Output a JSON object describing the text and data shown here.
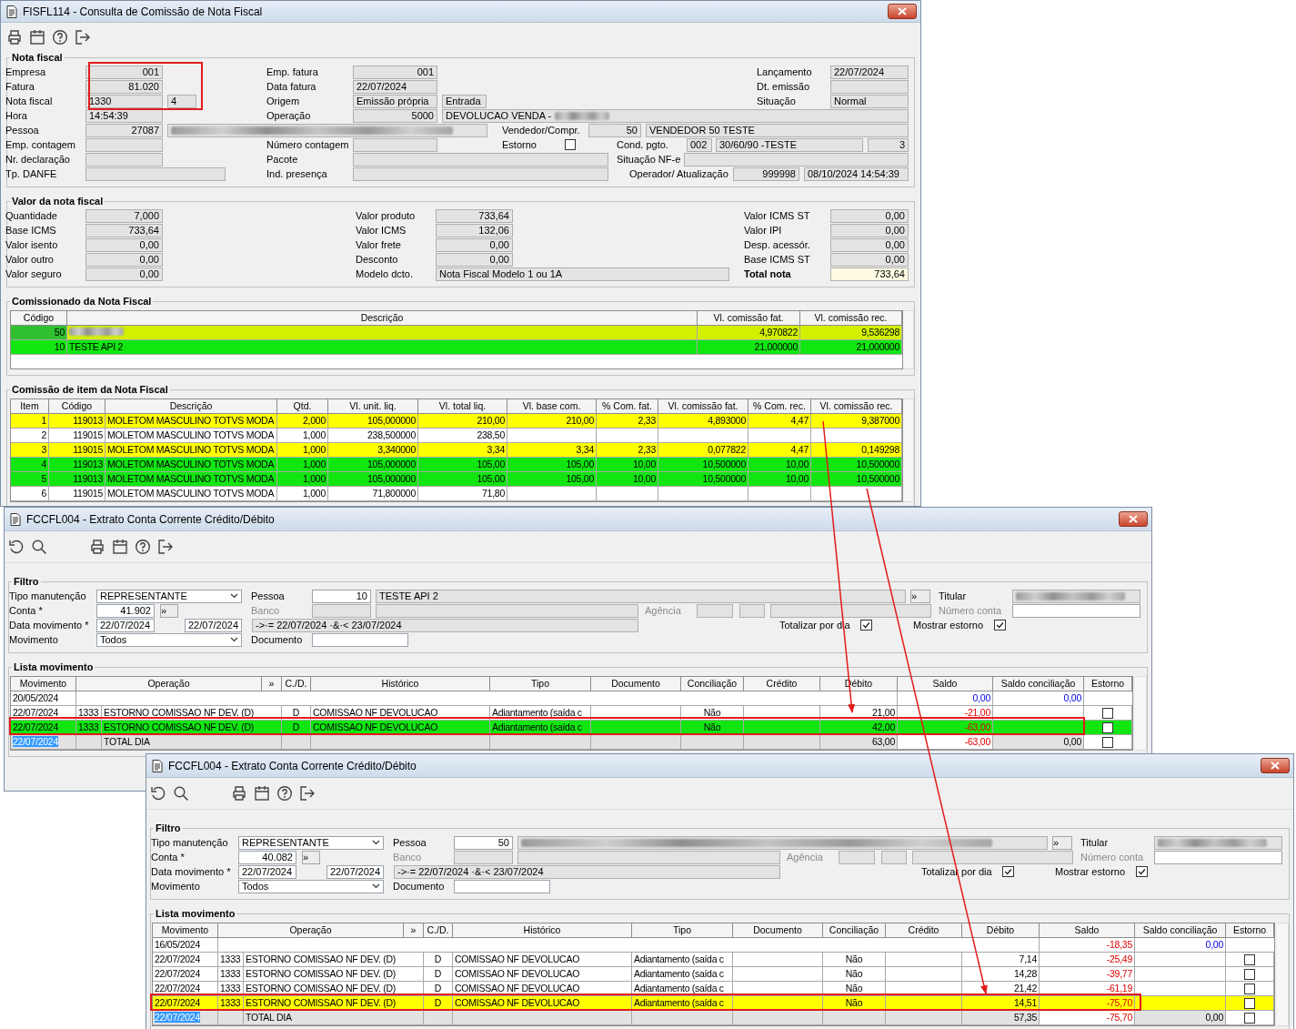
{
  "invoice_window": {
    "title": "FISFL114 - Consulta de Comissão de Nota Fiscal",
    "nota_fiscal": {
      "title": "Nota fiscal",
      "rows": [
        {
          "left": [
            {
              "kind": "label",
              "text": "Empresa"
            },
            {
              "kind": "field",
              "value": "001"
            }
          ],
          "middle": [
            {
              "kind": "label",
              "text": "Emp. fatura"
            },
            {
              "kind": "field",
              "value": "001"
            }
          ],
          "right": [
            {
              "kind": "label",
              "text": "Lançamento"
            },
            {
              "kind": "field",
              "value": "22/07/2024"
            }
          ]
        },
        {
          "left": [
            {
              "kind": "label",
              "text": "Fatura"
            },
            {
              "kind": "field",
              "value": "81.020"
            }
          ],
          "middle": [
            {
              "kind": "label",
              "text": "Data fatura"
            },
            {
              "kind": "field",
              "value": "22/07/2024"
            }
          ],
          "right": [
            {
              "kind": "label",
              "text": "Dt. emissão"
            },
            {
              "kind": "field"
            }
          ]
        },
        {
          "left": [
            {
              "kind": "label",
              "text": "Nota fiscal"
            },
            {
              "kind": "field",
              "value": "1330"
            },
            {
              "kind": "field",
              "value": "4"
            }
          ],
          "middle": [
            {
              "kind": "label",
              "text": "Origem"
            },
            {
              "kind": "field",
              "value": "Emissão própria"
            },
            {
              "kind": "field",
              "value": "Entrada"
            }
          ],
          "right": [
            {
              "kind": "label",
              "text": "Situação"
            },
            {
              "kind": "field",
              "value": "Normal"
            }
          ]
        },
        {
          "left": [
            {
              "kind": "label",
              "text": "Hora"
            },
            {
              "kind": "field",
              "value": "14:54:39"
            }
          ],
          "middle": [
            {
              "kind": "label",
              "text": "Operação"
            },
            {
              "kind": "field",
              "value": "5000"
            },
            {
              "kind": "field",
              "value": "DEVOLUCAO VENDA -",
              "redacted": true
            }
          ]
        },
        {
          "left": [
            {
              "kind": "label",
              "text": "Pessoa"
            },
            {
              "kind": "field",
              "value": "27087"
            },
            {
              "kind": "field",
              "redacted": true
            }
          ],
          "right": [
            {
              "kind": "label",
              "text": "Vendedor/Compr."
            },
            {
              "kind": "field",
              "value": "50"
            },
            {
              "kind": "field",
              "value": "VENDEDOR 50 TESTE"
            }
          ]
        },
        {
          "left": [
            {
              "kind": "label",
              "text": "Emp. contagem"
            },
            {
              "kind": "field"
            }
          ],
          "middle": [
            {
              "kind": "label",
              "text": "Número contagem"
            },
            {
              "kind": "field"
            },
            {
              "kind": "label",
              "text": "Estorno"
            },
            {
              "kind": "check",
              "checked": false
            }
          ],
          "right": [
            {
              "kind": "label",
              "text": "Cond. pgto."
            },
            {
              "kind": "field",
              "value": "002"
            },
            {
              "kind": "field",
              "value": "30/60/90 -TESTE"
            },
            {
              "kind": "field",
              "value": "3"
            }
          ]
        },
        {
          "left": [
            {
              "kind": "label",
              "text": "Nr. declaração"
            },
            {
              "kind": "field"
            }
          ],
          "middle": [
            {
              "kind": "label",
              "text": "Pacote"
            },
            {
              "kind": "field"
            }
          ],
          "right": [
            {
              "kind": "label",
              "text": "Situação NF-e"
            },
            {
              "kind": "field"
            }
          ]
        },
        {
          "left": [
            {
              "kind": "label",
              "text": "Tp. DANFE"
            },
            {
              "kind": "field"
            }
          ],
          "middle": [
            {
              "kind": "label",
              "text": "Ind. presença"
            },
            {
              "kind": "field"
            }
          ],
          "right": [
            {
              "kind": "label",
              "text": "Operador/ Atualização"
            },
            {
              "kind": "field",
              "value": "999998"
            },
            {
              "kind": "field",
              "value": "08/10/2024 14:54:39"
            }
          ]
        }
      ]
    },
    "valores": {
      "title": "Valor da nota fiscal",
      "rows": [
        [
          {
            "kind": "label",
            "text": "Quantidade"
          },
          {
            "kind": "field",
            "value": "7,000"
          },
          {
            "kind": "label",
            "text": "Valor produto"
          },
          {
            "kind": "field",
            "value": "733,64"
          },
          {
            "kind": "label",
            "text": "Valor ICMS ST"
          },
          {
            "kind": "field",
            "value": "0,00"
          }
        ],
        [
          {
            "kind": "label",
            "text": "Base ICMS"
          },
          {
            "kind": "field",
            "value": "733,64"
          },
          {
            "kind": "label",
            "text": "Valor ICMS"
          },
          {
            "kind": "field",
            "value": "132,06"
          },
          {
            "kind": "label",
            "text": "Valor IPI"
          },
          {
            "kind": "field",
            "value": "0,00"
          }
        ],
        [
          {
            "kind": "label",
            "text": "Valor isento"
          },
          {
            "kind": "field",
            "value": "0,00"
          },
          {
            "kind": "label",
            "text": "Valor frete"
          },
          {
            "kind": "field",
            "value": "0,00"
          },
          {
            "kind": "label",
            "text": "Desp. acessór."
          },
          {
            "kind": "field",
            "value": "0,00"
          }
        ],
        [
          {
            "kind": "label",
            "text": "Valor outro"
          },
          {
            "kind": "field",
            "value": "0,00"
          },
          {
            "kind": "label",
            "text": "Desconto"
          },
          {
            "kind": "field",
            "value": "0,00"
          },
          {
            "kind": "label",
            "text": "Base ICMS ST"
          },
          {
            "kind": "field",
            "value": "0,00"
          }
        ],
        [
          {
            "kind": "label",
            "text": "Valor seguro"
          },
          {
            "kind": "field",
            "value": "0,00"
          },
          {
            "kind": "label",
            "text": "Modelo dcto."
          },
          {
            "kind": "field",
            "value": "Nota Fiscal Modelo 1 ou 1A"
          },
          {
            "kind": "total-label",
            "text": "Total nota"
          },
          {
            "kind": "total-field",
            "value": "733,64"
          }
        ]
      ]
    },
    "comissionados": {
      "title": "Comissionado da Nota Fiscal",
      "columns": [
        "Código",
        "Descrição",
        "Vl. comissão fat.",
        "Vl. comissão rec."
      ],
      "rows": [
        {
          "codigo": "50",
          "redacted": true,
          "selected": true,
          "vl_fat": "4,970822",
          "vl_rec": "9,536298",
          "color": "#d2f000"
        },
        {
          "codigo": "10",
          "descricao": "TESTE API 2",
          "redacted": false,
          "selected": false,
          "vl_fat": "21,000000",
          "vl_rec": "21,000000",
          "color": "#11e611"
        }
      ]
    },
    "itens": {
      "title": "Comissão de item da Nota Fiscal",
      "columns": [
        "Item",
        "Código",
        "Descrição",
        "Qtd.",
        "Vl. unit. liq.",
        "Vl. total liq.",
        "Vl. base com.",
        "% Com. fat.",
        "Vl. comissão fat.",
        "% Com. rec.",
        "Vl. comissão rec."
      ],
      "rows": [
        {
          "color": "#ffff00",
          "cells": [
            "1",
            "119013",
            "MOLETOM MASCULINO TOTVS MODA",
            "2,000",
            "105,000000",
            "210,00",
            "210,00",
            "2,33",
            "4,893000",
            "4,47",
            "9,387000"
          ]
        },
        {
          "color": "#ffffff",
          "cells": [
            "2",
            "119015",
            "MOLETOM MASCULINO TOTVS MODA",
            "1,000",
            "238,500000",
            "238,50"
          ]
        },
        {
          "color": "#ffff00",
          "cells": [
            "3",
            "119015",
            "MOLETOM MASCULINO TOTVS MODA",
            "1,000",
            "3,340000",
            "3,34",
            "3,34",
            "2,33",
            "0,077822",
            "4,47",
            "0,149298"
          ]
        },
        {
          "color": "#11e611",
          "cells": [
            "4",
            "119013",
            "MOLETOM MASCULINO TOTVS MODA",
            "1,000",
            "105,000000",
            "105,00",
            "105,00",
            "10,00",
            "10,500000",
            "10,00",
            "10,500000"
          ]
        },
        {
          "color": "#11e611",
          "cells": [
            "5",
            "119013",
            "MOLETOM MASCULINO TOTVS MODA",
            "1,000",
            "105,000000",
            "105,00",
            "105,00",
            "10,00",
            "10,500000",
            "10,00",
            "10,500000"
          ]
        },
        {
          "color": "#ffffff",
          "cells": [
            "6",
            "119015",
            "MOLETOM MASCULINO TOTVS MODA",
            "1,000",
            "71,800000",
            "71,80"
          ]
        }
      ]
    }
  },
  "statement_windows": [
    {
      "title": "FCCFL004 - Extrato Conta Corrente Crédito/Débito",
      "filter": {
        "title": "Filtro",
        "rows": [
          [
            {
              "kind": "label",
              "text": "Tipo manutenção"
            },
            {
              "kind": "dropdown",
              "value": "REPRESENTANTE"
            },
            {
              "kind": "label",
              "text": "Pessoa"
            },
            {
              "kind": "input",
              "value": "10"
            },
            {
              "kind": "field",
              "value": "TESTE API 2"
            },
            {
              "kind": "button",
              "text": "»"
            },
            {
              "kind": "label",
              "text": "Titular"
            },
            {
              "kind": "field",
              "redacted": true
            }
          ],
          [
            {
              "kind": "label",
              "text": "Conta *"
            },
            {
              "kind": "input",
              "value": "41.902"
            },
            {
              "kind": "button",
              "text": "»"
            },
            {
              "kind": "muted-label",
              "text": "Banco"
            },
            {
              "kind": "field"
            },
            {
              "kind": "field"
            },
            {
              "kind": "muted-label",
              "text": "Agência"
            },
            {
              "kind": "field"
            },
            {
              "kind": "field"
            },
            {
              "kind": "field"
            },
            {
              "kind": "muted-label",
              "text": "Número conta"
            },
            {
              "kind": "input"
            }
          ],
          [
            {
              "kind": "label",
              "text": "Data movimento *"
            },
            {
              "kind": "input",
              "value": "22/07/2024"
            },
            {
              "kind": "input",
              "value": "22/07/2024"
            },
            {
              "kind": "field",
              "value": "->·= 22/07/2024 ·&·< 23/07/2024"
            },
            {
              "kind": "label",
              "text": "Totalizar por dia"
            },
            {
              "kind": "check",
              "checked": true
            },
            {
              "kind": "label",
              "text": "Mostrar estorno"
            },
            {
              "kind": "check",
              "checked": true
            }
          ],
          [
            {
              "kind": "label",
              "text": "Movimento"
            },
            {
              "kind": "dropdown",
              "value": "Todos"
            },
            {
              "kind": "label",
              "text": "Documento"
            },
            {
              "kind": "input"
            }
          ]
        ]
      },
      "list": {
        "title": "Lista movimento",
        "columns": [
          "Movimento",
          "Operação",
          "»",
          "C./D.",
          "Histórico",
          "Tipo",
          "Documento",
          "Conciliação",
          "Crédito",
          "Débito",
          "Saldo",
          "Saldo conciliação",
          "Estorno"
        ],
        "rows": [
          {
            "kind": "opening",
            "date": "20/05/2024",
            "saldo": "0,00",
            "saldo_negative": false,
            "saldo_conciliacao": "0,00"
          },
          {
            "kind": "entry",
            "color": "#ffffff",
            "date": "22/07/2024",
            "op_code": "1333",
            "operation": "ESTORNO COMISSAO NF DEV. (D)",
            "cd": "D",
            "historico": "COMISSAO NF DEVOLUCAO",
            "tipo": "Adiantamento (saída c",
            "conciliacao": "Não",
            "debito": "21,00",
            "saldo": "-21,00",
            "saldo_negative": true,
            "checked": false
          },
          {
            "kind": "entry",
            "color": "#11e611",
            "date": "22/07/2024",
            "op_code": "1333",
            "operation": "ESTORNO COMISSAO NF DEV. (D)",
            "cd": "D",
            "historico": "COMISSAO NF DEVOLUCAO",
            "tipo": "Adiantamento (saída c",
            "conciliacao": "Não",
            "debito": "42,00",
            "saldo": "-63,00",
            "saldo_negative": true,
            "checked": false
          },
          {
            "kind": "total",
            "date": "22/07/2024",
            "date_selected": true,
            "label": "TOTAL DIA",
            "debito": "63,00",
            "saldo": "-63,00",
            "saldo_negative": true,
            "saldo_conciliacao": "0,00",
            "checked": false
          }
        ]
      }
    },
    {
      "title": "FCCFL004 - Extrato Conta Corrente Crédito/Débito",
      "filter": {
        "title": "Filtro",
        "rows": [
          [
            {
              "kind": "label",
              "text": "Tipo manutenção"
            },
            {
              "kind": "dropdown",
              "value": "REPRESENTANTE"
            },
            {
              "kind": "label",
              "text": "Pessoa"
            },
            {
              "kind": "input",
              "value": "50"
            },
            {
              "kind": "field",
              "redacted": true
            },
            {
              "kind": "button",
              "text": "»"
            },
            {
              "kind": "label",
              "text": "Titular"
            },
            {
              "kind": "field",
              "redacted": true
            }
          ],
          [
            {
              "kind": "label",
              "text": "Conta *"
            },
            {
              "kind": "input",
              "value": "40.082"
            },
            {
              "kind": "button",
              "text": "»"
            },
            {
              "kind": "muted-label",
              "text": "Banco"
            },
            {
              "kind": "field"
            },
            {
              "kind": "field"
            },
            {
              "kind": "muted-label",
              "text": "Agência"
            },
            {
              "kind": "field"
            },
            {
              "kind": "field"
            },
            {
              "kind": "field"
            },
            {
              "kind": "muted-label",
              "text": "Número conta"
            },
            {
              "kind": "input"
            }
          ],
          [
            {
              "kind": "label",
              "text": "Data movimento *"
            },
            {
              "kind": "input",
              "value": "22/07/2024"
            },
            {
              "kind": "input",
              "value": "22/07/2024"
            },
            {
              "kind": "field",
              "value": "->·= 22/07/2024 ·&·< 23/07/2024"
            },
            {
              "kind": "label",
              "text": "Totalizar por dia"
            },
            {
              "kind": "check",
              "checked": true
            },
            {
              "kind": "label",
              "text": "Mostrar estorno"
            },
            {
              "kind": "check",
              "checked": true
            }
          ],
          [
            {
              "kind": "label",
              "text": "Movimento"
            },
            {
              "kind": "dropdown",
              "value": "Todos"
            },
            {
              "kind": "label",
              "text": "Documento"
            },
            {
              "kind": "input"
            }
          ]
        ]
      },
      "list": {
        "title": "Lista movimento",
        "columns": [
          "Movimento",
          "Operação",
          "»",
          "C./D.",
          "Histórico",
          "Tipo",
          "Documento",
          "Conciliação",
          "Crédito",
          "Débito",
          "Saldo",
          "Saldo conciliação",
          "Estorno"
        ],
        "rows": [
          {
            "kind": "opening",
            "date": "16/05/2024",
            "saldo": "-18,35",
            "saldo_negative": true,
            "saldo_conciliacao": "0,00"
          },
          {
            "kind": "entry",
            "color": "#ffffff",
            "date": "22/07/2024",
            "op_code": "1333",
            "operation": "ESTORNO COMISSAO NF DEV. (D)",
            "cd": "D",
            "historico": "COMISSAO NF DEVOLUCAO",
            "tipo": "Adiantamento (saída c",
            "conciliacao": "Não",
            "debito": "7,14",
            "saldo": "-25,49",
            "saldo_negative": true,
            "checked": false
          },
          {
            "kind": "entry",
            "color": "#ffffff",
            "date": "22/07/2024",
            "op_code": "1333",
            "operation": "ESTORNO COMISSAO NF DEV. (D)",
            "cd": "D",
            "historico": "COMISSAO NF DEVOLUCAO",
            "tipo": "Adiantamento (saída c",
            "conciliacao": "Não",
            "debito": "14,28",
            "saldo": "-39,77",
            "saldo_negative": true,
            "checked": false
          },
          {
            "kind": "entry",
            "color": "#ffffff",
            "date": "22/07/2024",
            "op_code": "1333",
            "operation": "ESTORNO COMISSAO NF DEV. (D)",
            "cd": "D",
            "historico": "COMISSAO NF DEVOLUCAO",
            "tipo": "Adiantamento (saída c",
            "conciliacao": "Não",
            "debito": "21,42",
            "saldo": "-61,19",
            "saldo_negative": true,
            "checked": false
          },
          {
            "kind": "entry",
            "color": "#ffff00",
            "date": "22/07/2024",
            "op_code": "1333",
            "operation": "ESTORNO COMISSAO NF DEV. (D)",
            "cd": "D",
            "historico": "COMISSAO NF DEVOLUCAO",
            "tipo": "Adiantamento (saída c",
            "conciliacao": "Não",
            "debito": "14,51",
            "saldo": "-75,70",
            "saldo_negative": true,
            "checked": false
          },
          {
            "kind": "total",
            "date": "22/07/2024",
            "date_selected": true,
            "label": "TOTAL DIA",
            "debito": "57,35",
            "saldo": "-75,70",
            "saldo_negative": true,
            "saldo_conciliacao": "0,00",
            "checked": false
          }
        ]
      }
    }
  ]
}
